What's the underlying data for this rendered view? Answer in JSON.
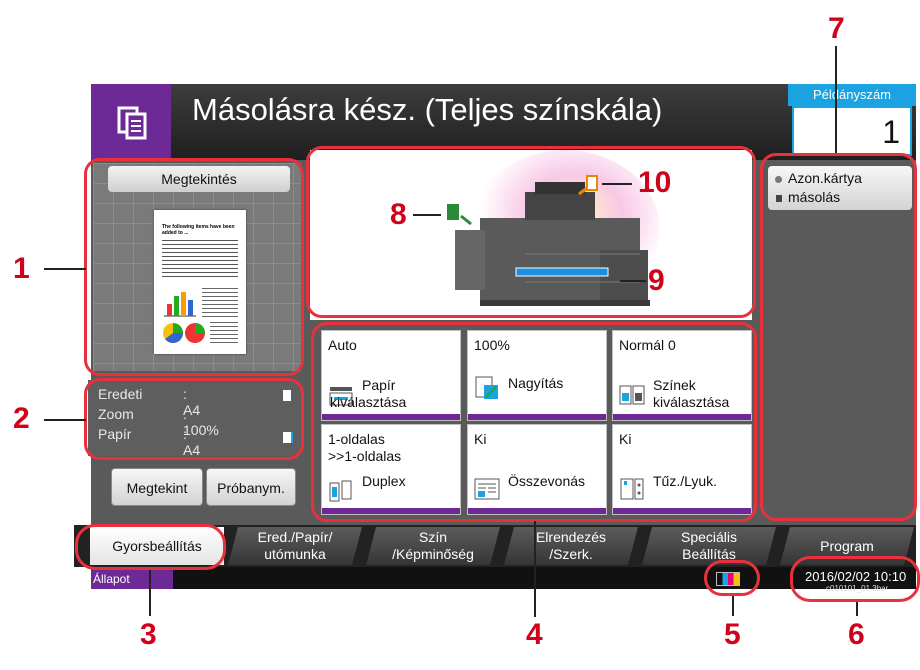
{
  "header": {
    "title": "Másolásra kész. (Teljes színskála)",
    "copies_label": "Példányszám",
    "copies_value": "1"
  },
  "preview": {
    "button_label": "Megtekintés",
    "doc_heading": "The following items have been added to ..."
  },
  "info": {
    "rows": [
      {
        "label": "Eredeti",
        "value": ": A4"
      },
      {
        "label": "Zoom",
        "value": ": 100%"
      },
      {
        "label": "Papír",
        "value": ": A4"
      }
    ]
  },
  "buttons": {
    "preview": "Megtekint",
    "test_copy": "Próbanym."
  },
  "side": {
    "id_card_line1": "Azon.kártya",
    "id_card_line2": "másolás"
  },
  "tiles": [
    {
      "value": "Auto",
      "label1": "Papír",
      "label2": "kiválasztása",
      "icon": "paper-tray-icon"
    },
    {
      "value": "100%",
      "label1": "Nagyítás",
      "label2": "",
      "icon": "zoom-icon"
    },
    {
      "value": "Normál 0",
      "label1": "Színek",
      "label2": "kiválasztása",
      "icon": "color-select-icon"
    },
    {
      "value1": "1-oldalas",
      "value2": ">>1-oldalas",
      "label1": "Duplex",
      "label2": "",
      "icon": "duplex-icon"
    },
    {
      "value": "Ki",
      "label1": "Összevonás",
      "label2": "",
      "icon": "combine-icon"
    },
    {
      "value": "Ki",
      "label1": "Tűz./Lyuk.",
      "label2": "",
      "icon": "staple-punch-icon"
    }
  ],
  "tabs": [
    {
      "line1": "Gyorsbeállítás",
      "line2": ""
    },
    {
      "line1": "Ered./Papír/",
      "line2": "utómunka"
    },
    {
      "line1": "Szín",
      "line2": "/Képminőség"
    },
    {
      "line1": "Elrendezés",
      "line2": "/Szerk."
    },
    {
      "line1": "Speciális",
      "line2": "Beállítás"
    },
    {
      "line1": "Program",
      "line2": ""
    }
  ],
  "status": {
    "label": "Állapot",
    "datetime": "2016/02/02  10:10",
    "code": "c010101_01.3bar"
  },
  "callouts": {
    "n1": "1",
    "n2": "2",
    "n3": "3",
    "n4": "4",
    "n5": "5",
    "n6": "6",
    "n7": "7",
    "n8": "8",
    "n9": "9",
    "n10": "10"
  },
  "colors": {
    "accent_purple": "#6d2a97",
    "highlight_blue": "#1aa3e0",
    "callout_red": "#d0021b",
    "callout_ring": "#e8313c"
  }
}
